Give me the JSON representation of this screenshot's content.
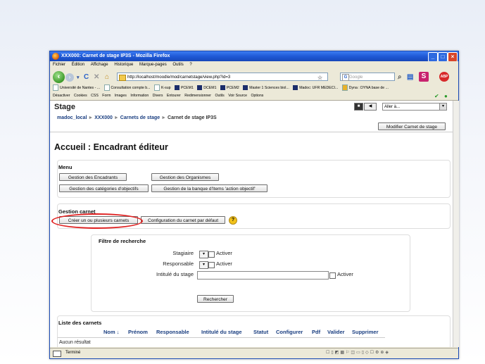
{
  "window": {
    "title": "XXX000: Carnet de stage IP3S - Mozilla Firefox"
  },
  "menubar": [
    "Fichier",
    "Édition",
    "Affichage",
    "Historique",
    "Marque-pages",
    "Outils",
    "?"
  ],
  "navigation": {
    "url": "http://localhost/moodle/mod/carnetstage/view.php?id=3",
    "search_placeholder": "Google"
  },
  "bookmarks": [
    "Université de Nantes - ...",
    "Consultation compte b...",
    "K-sup",
    "PCEM1",
    "DCEM1",
    "PCEM2",
    "Master 1 Sciences biol...",
    "Madoc: UFR MEDECI...",
    "Dyna : DYNA base de ..."
  ],
  "webdev_toolbar": [
    "Désactiver",
    "Cookies",
    "CSS",
    "Form",
    "Images",
    "Information",
    "Divers",
    "Entourer",
    "Redimensionner",
    "Outils",
    "Voir Source",
    "Options"
  ],
  "page": {
    "site_name": "Stage",
    "jump_label": "Aller à...",
    "breadcrumb": [
      "madoc_local",
      "XXX000",
      "Carnets de stage",
      "Carnet de stage IP3S"
    ],
    "modify_button": "Modifier Carnet de stage",
    "heading": "Accueil : Encadrant éditeur",
    "menu": {
      "title": "Menu",
      "btn_encadrants": "Gestion des Encadrants",
      "btn_organismes": "Gestion des Organismes",
      "btn_categories": "Gestion des catégories d'objectifs",
      "btn_banque": "Gestion de la banque d'Items 'action objectif'"
    },
    "gestion": {
      "title": "Gestion carnet",
      "btn_creer": "Créer un ou plusieurs carnets",
      "btn_config": "Configuration du carnet par défaut"
    },
    "filtre": {
      "title": "Filtre de recherche",
      "stagiaire": "Stagiaire",
      "responsable": "Responsable",
      "intitule": "Intitulé du stage",
      "activer": "Activer",
      "rechercher": "Rechercher"
    },
    "liste": {
      "title": "Liste des carnets",
      "columns": [
        "Nom ↓",
        "Prénom",
        "Responsable",
        "Intitulé du stage",
        "Statut",
        "Configurer",
        "Pdf",
        "Valider",
        "Supprimer"
      ],
      "empty": "Aucun résultat"
    }
  },
  "status": "Terminé"
}
